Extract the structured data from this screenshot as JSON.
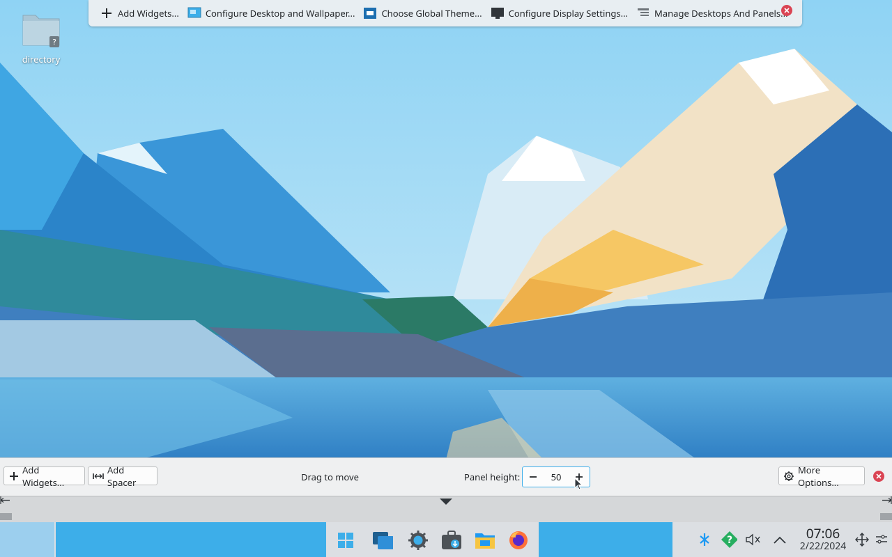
{
  "top_toolbar": {
    "items": [
      {
        "label": "Add Widgets...",
        "icon": "plus-icon"
      },
      {
        "label": "Configure Desktop and Wallpaper...",
        "icon": "wallpaper-icon"
      },
      {
        "label": "Choose Global Theme...",
        "icon": "theme-icon"
      },
      {
        "label": "Configure Display Settings...",
        "icon": "display-icon"
      },
      {
        "label": "Manage Desktops And Panels...",
        "icon": "panels-icon"
      }
    ],
    "close_icon": "close-icon"
  },
  "desktop": {
    "icons": [
      {
        "label": "directory",
        "icon": "folder-unknown-icon"
      }
    ]
  },
  "panel_config": {
    "add_widgets_label": "Add Widgets...",
    "add_spacer_label": "Add Spacer",
    "drag_label": "Drag to move",
    "panel_height_label": "Panel height:",
    "panel_height_value": "50",
    "more_options_label": "More Options...",
    "decrease_icon": "minus-icon",
    "increase_icon": "plus-icon",
    "close_icon": "close-icon"
  },
  "taskbar": {
    "tasks": [
      "start-menu-icon",
      "overview-icon",
      "system-settings-icon",
      "discover-icon",
      "dolphin-icon",
      "firefox-icon"
    ],
    "tray": [
      "kde-connect-icon",
      "updates-icon",
      "volume-muted-icon",
      "tray-expand-icon"
    ],
    "clock": {
      "time": "07:06",
      "date": "2/22/2024"
    },
    "trailing": [
      "move-panel-icon",
      "panel-settings-icon"
    ]
  },
  "colors": {
    "accent": "#3daee9",
    "close": "#da4453",
    "panel_bg": "#eff0f1"
  }
}
